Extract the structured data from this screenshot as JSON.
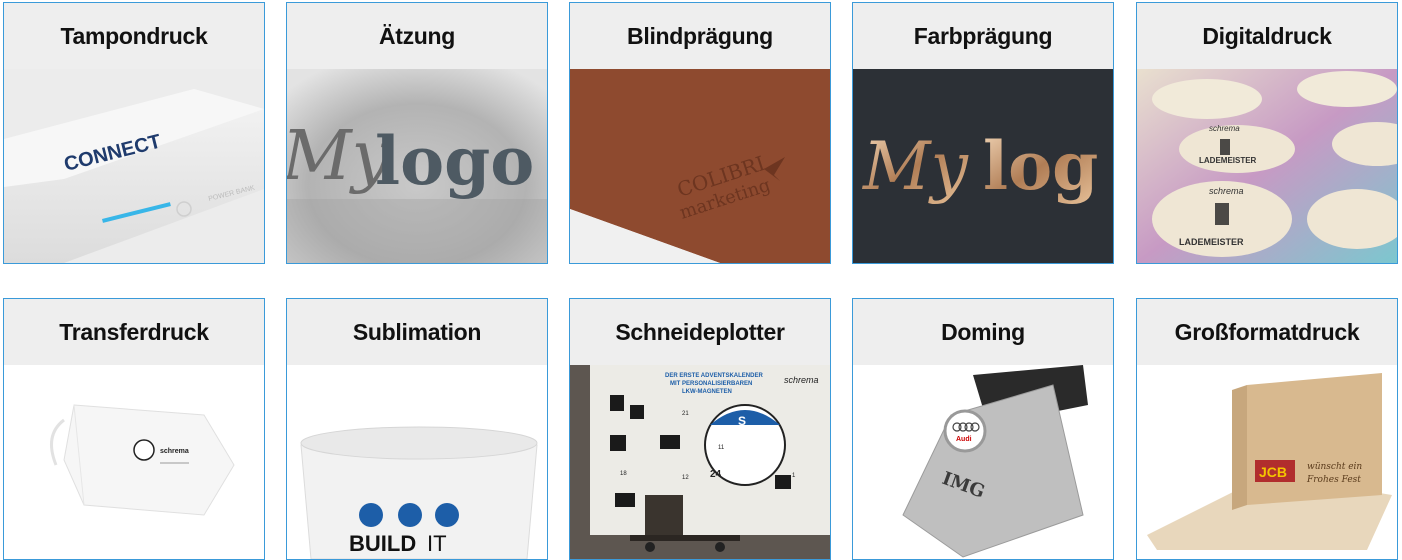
{
  "cards": [
    {
      "title": "Tampondruck",
      "image": "powerbank-pad-print",
      "image_text": [
        "CONNECT",
        "POWER BANK"
      ]
    },
    {
      "title": "Ätzung",
      "image": "etched-logo",
      "image_text": [
        "My",
        "logo"
      ]
    },
    {
      "title": "Blindprägung",
      "image": "leather-blind-embossing",
      "image_text": [
        "COLIBRI",
        "marketing"
      ]
    },
    {
      "title": "Farbprägung",
      "image": "color-foil-embossing",
      "image_text": [
        "My",
        "log"
      ]
    },
    {
      "title": "Digitaldruck",
      "image": "printed-coasters",
      "image_text": [
        "schrema",
        "LADEMEISTER",
        "schrema",
        "LADEMEISTER"
      ]
    },
    {
      "title": "Transferdruck",
      "image": "face-mask-transfer",
      "image_text": [
        "schrema"
      ]
    },
    {
      "title": "Sublimation",
      "image": "mug-sublimation",
      "image_text": [
        "BUILD",
        "IT"
      ]
    },
    {
      "title": "Schneideplotter",
      "image": "advent-calendar-plotter",
      "image_text": [
        "DER ERSTE ADVENTSKALENDER",
        "MIT PERSONALISIERBAREN",
        "LKW-MAGNETEN",
        "schrema",
        "S",
        "21",
        "11",
        "18",
        "24",
        "12",
        "1"
      ]
    },
    {
      "title": "Doming",
      "image": "usb-stick-doming",
      "image_text": [
        "Audi",
        "IMG"
      ]
    },
    {
      "title": "Großformatdruck",
      "image": "box-large-format",
      "image_text": [
        "JCB",
        "wünscht ein",
        "Frohes Fest"
      ]
    }
  ]
}
